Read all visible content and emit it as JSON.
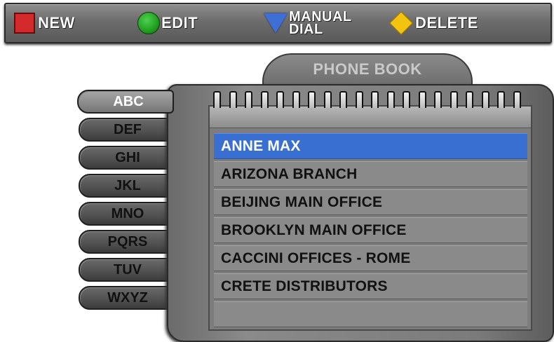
{
  "toolbar": {
    "new_label": "NEW",
    "edit_label": "EDIT",
    "manual_dial_label": "MANUAL\nDIAL",
    "delete_label": "DELETE",
    "colors": {
      "new": "#d32b2b",
      "edit": "#1c9a1c",
      "manual_dial": "#3d6fd6",
      "delete": "#f2c30f"
    }
  },
  "folder": {
    "title": "PHONE BOOK"
  },
  "alphabet_tabs": [
    {
      "label": "ABC",
      "active": true
    },
    {
      "label": "DEF",
      "active": false
    },
    {
      "label": "GHI",
      "active": false
    },
    {
      "label": "JKL",
      "active": false
    },
    {
      "label": "MNO",
      "active": false
    },
    {
      "label": "PQRS",
      "active": false
    },
    {
      "label": "TUV",
      "active": false
    },
    {
      "label": "WXYZ",
      "active": false
    }
  ],
  "contacts": [
    {
      "name": "ANNE MAX",
      "selected": true
    },
    {
      "name": "ARIZONA BRANCH",
      "selected": false
    },
    {
      "name": "BEIJING MAIN OFFICE",
      "selected": false
    },
    {
      "name": "BROOKLYN MAIN OFFICE",
      "selected": false
    },
    {
      "name": "CACCINI OFFICES - ROME",
      "selected": false
    },
    {
      "name": "CRETE DISTRIBUTORS",
      "selected": false
    },
    {
      "name": "",
      "selected": false
    }
  ],
  "selection_color": "#3a6fd2"
}
